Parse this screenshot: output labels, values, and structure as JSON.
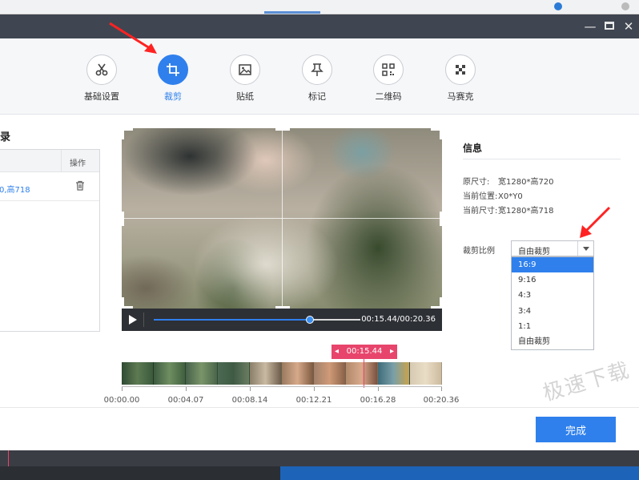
{
  "toolbar": {
    "tools": [
      {
        "label": "基础设置",
        "icon": "scissors-icon"
      },
      {
        "label": "裁剪",
        "icon": "crop-icon"
      },
      {
        "label": "贴纸",
        "icon": "image-icon"
      },
      {
        "label": "标记",
        "icon": "pin-icon"
      },
      {
        "label": "二维码",
        "icon": "qrcode-icon"
      },
      {
        "label": "马赛克",
        "icon": "mosaic-icon"
      }
    ],
    "active_index": 1
  },
  "left_panel": {
    "title": "录",
    "header_op": "操作",
    "row_value": "0,高718"
  },
  "player": {
    "time": "00:15.44/00:20.36",
    "progress": 0.755
  },
  "timeline": {
    "marker": "00:15.44",
    "labels": [
      "00:00.00",
      "00:04.07",
      "00:08.14",
      "00:12.21",
      "00:16.28",
      "00:20.36"
    ]
  },
  "info": {
    "title": "信息",
    "rows": [
      {
        "key": "原尺寸:",
        "value": "宽1280*高720"
      },
      {
        "key": "当前位置:",
        "value": "X0*Y0"
      },
      {
        "key": "当前尺寸:",
        "value": "宽1280*高718"
      }
    ],
    "ratio_label": "裁剪比例",
    "ratio_value": "自由裁剪",
    "ratio_options": [
      "16:9",
      "9:16",
      "4:3",
      "3:4",
      "1:1",
      "自由裁剪"
    ],
    "ratio_highlighted": 0
  },
  "watermark": "极速下载",
  "done_label": "完成",
  "colors": {
    "accent": "#2f80ed",
    "marker": "#e8456c",
    "titlebar": "#3f4651"
  }
}
